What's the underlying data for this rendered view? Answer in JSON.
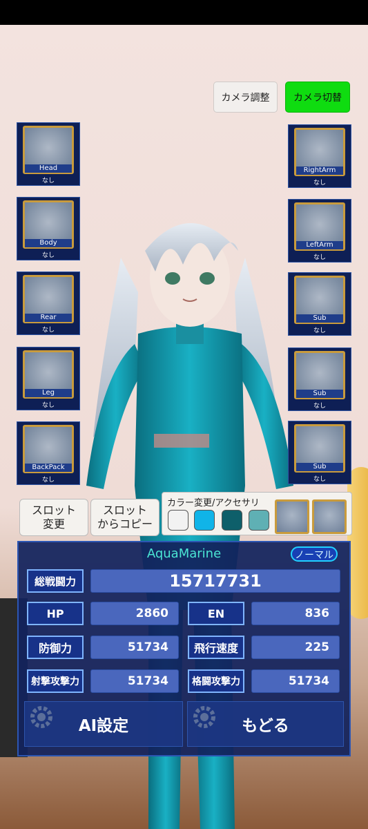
{
  "camera": {
    "adjust_label": "カメラ調整",
    "switch_label": "カメラ切替"
  },
  "left_slots": [
    {
      "name": "Head",
      "item": "なし"
    },
    {
      "name": "Body",
      "item": "なし"
    },
    {
      "name": "Rear",
      "item": "なし"
    },
    {
      "name": "Leg",
      "item": "なし"
    },
    {
      "name": "BackPack",
      "item": "なし"
    }
  ],
  "right_slots": [
    {
      "name": "RightArm",
      "item": "なし"
    },
    {
      "name": "LeftArm",
      "item": "なし"
    },
    {
      "name": "Sub",
      "item": "なし"
    },
    {
      "name": "Sub",
      "item": "なし"
    },
    {
      "name": "Sub",
      "item": "なし"
    }
  ],
  "actions": {
    "slot_change_line1": "スロット",
    "slot_change_line2": "変更",
    "slot_copy_line1": "スロット",
    "slot_copy_line2": "からコピー"
  },
  "accessory": {
    "title": "カラー変更/アクセサリ",
    "swatches": [
      "#f2f2f2",
      "#10b4e8",
      "#0e5f6a",
      "#5fb0b4"
    ]
  },
  "unit": {
    "name": "AquaMarine",
    "rank": "ノーマル"
  },
  "stats": {
    "total_label": "総戦闘力",
    "total_value": "15717731",
    "hp_label": "HP",
    "hp_value": "2860",
    "en_label": "EN",
    "en_value": "836",
    "defense_label": "防御力",
    "defense_value": "51734",
    "speed_label": "飛行速度",
    "speed_value": "225",
    "ranged_label": "射撃攻撃力",
    "ranged_value": "51734",
    "melee_label": "格闘攻撃力",
    "melee_value": "51734"
  },
  "buttons": {
    "ai_label": "AI設定",
    "back_label": "もどる"
  },
  "colors": {
    "accent_green": "#0fdc10",
    "panel_blue": "#12225c",
    "gold_frame": "#c99b3c",
    "cyan_text": "#4be6d4"
  }
}
